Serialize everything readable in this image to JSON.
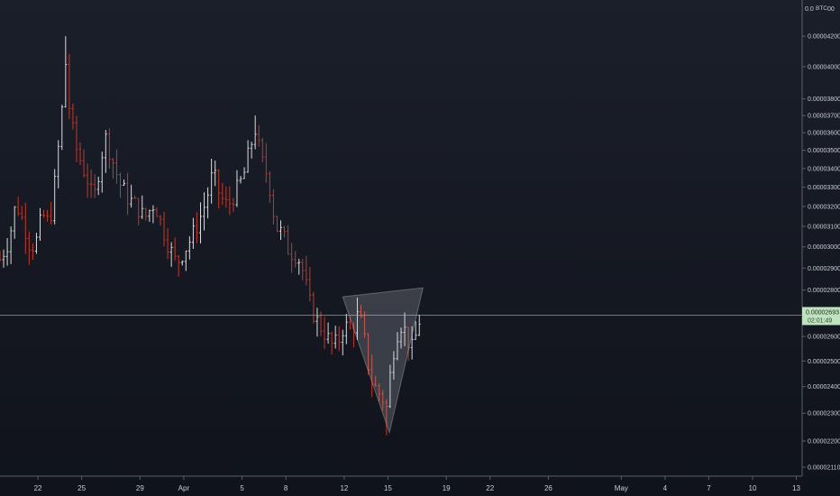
{
  "chart_data": {
    "type": "ohlc",
    "currency_label": "BTC",
    "top_tick_label": "0.0",
    "top_tick_label_suffix": "00",
    "y_scale": "log",
    "ylim": [
      2.08e-05,
      4.45e-05
    ],
    "y_ticks": [
      {
        "value": 4.2e-05,
        "label": "0.00004200"
      },
      {
        "value": 4e-05,
        "label": "0.00004000"
      },
      {
        "value": 3.8e-05,
        "label": "0.00003800"
      },
      {
        "value": 3.7e-05,
        "label": "0.00003700"
      },
      {
        "value": 3.6e-05,
        "label": "0.00003600"
      },
      {
        "value": 3.5e-05,
        "label": "0.00003500"
      },
      {
        "value": 3.4e-05,
        "label": "0.00003400"
      },
      {
        "value": 3.3e-05,
        "label": "0.00003300"
      },
      {
        "value": 3.2e-05,
        "label": "0.00003200"
      },
      {
        "value": 3.1e-05,
        "label": "0.00003100"
      },
      {
        "value": 3e-05,
        "label": "0.00003000"
      },
      {
        "value": 2.9e-05,
        "label": "0.00002900"
      },
      {
        "value": 2.8e-05,
        "label": "0.00002800"
      },
      {
        "value": 2.6e-05,
        "label": "0.00002600"
      },
      {
        "value": 2.5e-05,
        "label": "0.00002500"
      },
      {
        "value": 2.4e-05,
        "label": "0.00002400"
      },
      {
        "value": 2.3e-05,
        "label": "0.00002300"
      },
      {
        "value": 2.2e-05,
        "label": "0.00002200"
      },
      {
        "value": 2.11e-05,
        "label": "0.00002110"
      }
    ],
    "x_ticks": [
      {
        "day": 0,
        "label": "22"
      },
      {
        "day": 3,
        "label": "25"
      },
      {
        "day": 7,
        "label": "29"
      },
      {
        "day": 10,
        "label": "Apr"
      },
      {
        "day": 14,
        "label": "5"
      },
      {
        "day": 17,
        "label": "8"
      },
      {
        "day": 21,
        "label": "12"
      },
      {
        "day": 24,
        "label": "15"
      },
      {
        "day": 28,
        "label": "19"
      },
      {
        "day": 31,
        "label": "22"
      },
      {
        "day": 35,
        "label": "26"
      },
      {
        "day": 40,
        "label": "May"
      },
      {
        "day": 43,
        "label": "4"
      },
      {
        "day": 46,
        "label": "7"
      },
      {
        "day": 49,
        "label": "10"
      },
      {
        "day": 52,
        "label": "13"
      }
    ],
    "x_range_days": [
      -2.6,
      52.4
    ],
    "price_line": {
      "value": 2.69e-05,
      "label": "0.00002693",
      "countdown": "02:01:49"
    },
    "pattern_polygon": [
      {
        "day": 20.9,
        "price": 2.77e-05
      },
      {
        "day": 26.4,
        "price": 2.81e-05
      },
      {
        "day": 24.1,
        "price": 2.23e-05
      }
    ],
    "anchors": [
      [
        -2.6,
        2.94e-05
      ],
      [
        -2.0,
        3.03e-05
      ],
      [
        -1.5,
        3.22e-05
      ],
      [
        -1.0,
        3.12e-05
      ],
      [
        -0.6,
        3.02e-05
      ],
      [
        -0.2,
        3e-05
      ],
      [
        0.3,
        3.16e-05
      ],
      [
        0.8,
        3.11e-05
      ],
      [
        1.2,
        3.35e-05
      ],
      [
        1.6,
        3.68e-05
      ],
      [
        1.9,
        4.02e-05
      ],
      [
        2.2,
        3.7e-05
      ],
      [
        2.6,
        3.52e-05
      ],
      [
        3.1,
        3.4e-05
      ],
      [
        3.5,
        3.32e-05
      ],
      [
        3.8,
        3.22e-05
      ],
      [
        4.2,
        3.4e-05
      ],
      [
        4.6,
        3.58e-05
      ],
      [
        5.1,
        3.45e-05
      ],
      [
        5.6,
        3.32e-05
      ],
      [
        6.2,
        3.24e-05
      ],
      [
        6.8,
        3.2e-05
      ],
      [
        7.3,
        3.14e-05
      ],
      [
        8.0,
        3.22e-05
      ],
      [
        8.5,
        3.1e-05
      ],
      [
        9.0,
        3e-05
      ],
      [
        9.5,
        2.92e-05
      ],
      [
        10.0,
        2.98e-05
      ],
      [
        10.5,
        3.04e-05
      ],
      [
        11.0,
        3.12e-05
      ],
      [
        11.5,
        3.22e-05
      ],
      [
        12.0,
        3.38e-05
      ],
      [
        12.5,
        3.25e-05
      ],
      [
        13.0,
        3.2e-05
      ],
      [
        13.6,
        3.28e-05
      ],
      [
        14.1,
        3.36e-05
      ],
      [
        14.5,
        3.5e-05
      ],
      [
        14.9,
        3.62e-05
      ],
      [
        15.3,
        3.45e-05
      ],
      [
        15.8,
        3.35e-05
      ],
      [
        16.3,
        3.1e-05
      ],
      [
        16.8,
        3.06e-05
      ],
      [
        17.2,
        2.98e-05
      ],
      [
        17.8,
        2.96e-05
      ],
      [
        18.2,
        2.88e-05
      ],
      [
        18.6,
        2.75e-05
      ],
      [
        19.0,
        2.68e-05
      ],
      [
        19.4,
        2.64e-05
      ],
      [
        19.8,
        2.6e-05
      ],
      [
        20.2,
        2.56e-05
      ],
      [
        20.6,
        2.58e-05
      ],
      [
        21.0,
        2.65e-05
      ],
      [
        21.5,
        2.62e-05
      ],
      [
        22.0,
        2.7e-05
      ],
      [
        22.4,
        2.58e-05
      ],
      [
        22.8,
        2.43e-05
      ],
      [
        23.2,
        2.39e-05
      ],
      [
        23.6,
        2.36e-05
      ],
      [
        23.9,
        2.32e-05
      ],
      [
        24.3,
        2.52e-05
      ],
      [
        24.8,
        2.66e-05
      ],
      [
        25.2,
        2.62e-05
      ],
      [
        25.6,
        2.54e-05
      ],
      [
        25.9,
        2.6e-05
      ],
      [
        26.2,
        2.68e-05
      ]
    ]
  }
}
